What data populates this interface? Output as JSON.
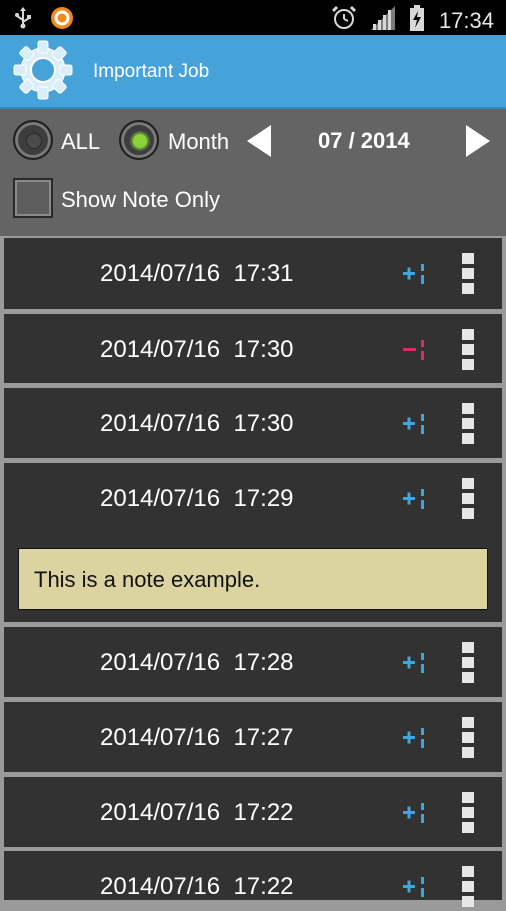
{
  "status_bar": {
    "time": "17:34",
    "icons": [
      "usb-icon",
      "app-notification-icon",
      "alarm-icon",
      "signal-icon",
      "battery-charging-icon"
    ]
  },
  "app_bar": {
    "title": "Important Job",
    "logo_icon": "gear-icon"
  },
  "filters": {
    "radio_all_label": "ALL",
    "radio_month_label": "Month",
    "selected": "Month",
    "month_value": "07 / 2014",
    "show_note_only_label": "Show Note Only",
    "show_note_only_checked": false
  },
  "entries": [
    {
      "datetime": "2014/07/16  17:31",
      "type": "plus"
    },
    {
      "datetime": "2014/07/16  17:30",
      "type": "minus"
    },
    {
      "datetime": "2014/07/16  17:30",
      "type": "plus"
    },
    {
      "datetime": "2014/07/16  17:29",
      "type": "plus",
      "note": "This is a note example."
    },
    {
      "datetime": "2014/07/16  17:28",
      "type": "plus"
    },
    {
      "datetime": "2014/07/16  17:27",
      "type": "plus"
    },
    {
      "datetime": "2014/07/16  17:22",
      "type": "plus"
    },
    {
      "datetime": "2014/07/16  17:22",
      "type": "plus"
    }
  ],
  "colors": {
    "app_bar": "#46a3d9",
    "plus": "#3aa7e0",
    "minus": "#e0286a",
    "note_background": "#dcd4a0"
  }
}
